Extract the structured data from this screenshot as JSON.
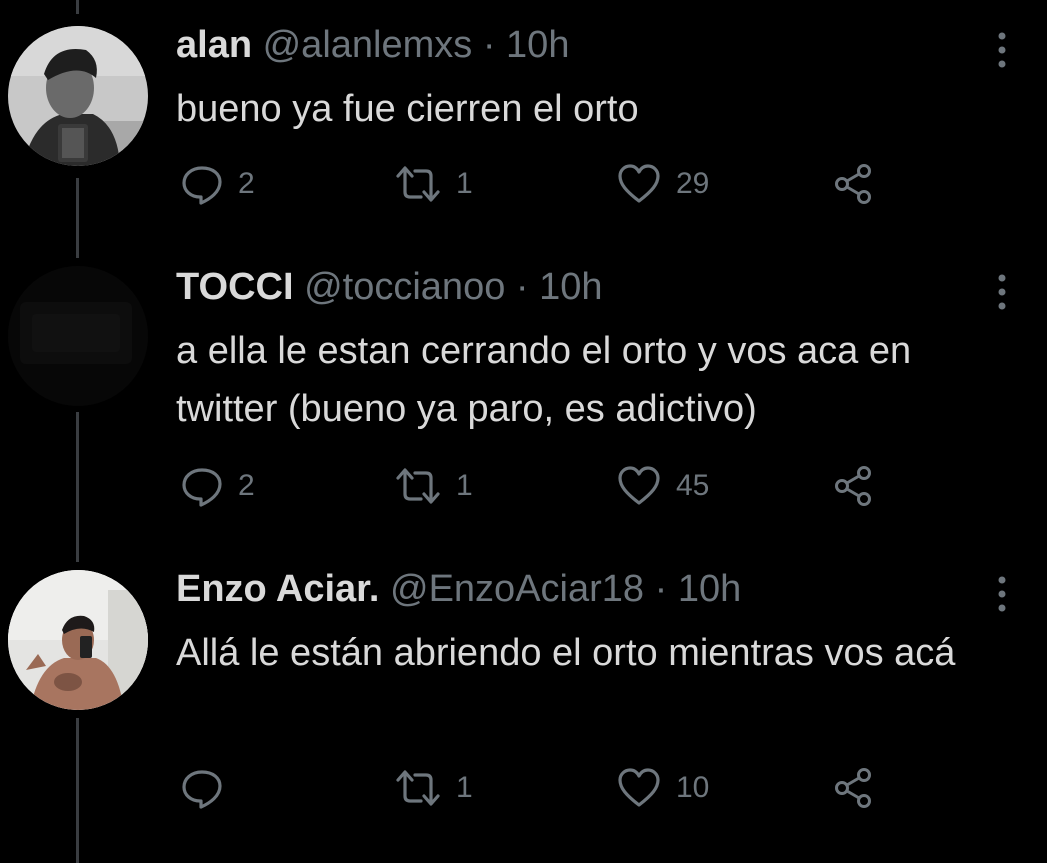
{
  "tweets": [
    {
      "name": "alan",
      "handle": "@alanlemxs",
      "separator": "·",
      "time": "10h",
      "text": "bueno ya fue cierren el orto",
      "replies": "2",
      "retweets": "1",
      "likes": "29"
    },
    {
      "name": "TOCCI",
      "handle": "@toccianoo",
      "separator": "·",
      "time": "10h",
      "text": "a ella le estan cerrando el orto y vos aca en twitter (bueno ya paro, es adictivo)",
      "replies": "2",
      "retweets": "1",
      "likes": "45"
    },
    {
      "name": "Enzo Aciar.",
      "handle": "@EnzoAciar18",
      "separator": "·",
      "time": "10h",
      "text": "Allá le están abriendo el orto mientras vos acá",
      "replies": "",
      "retweets": "1",
      "likes": "10"
    }
  ],
  "icons": {
    "reply": "speech-bubble-icon",
    "retweet": "retweet-icon",
    "like": "heart-icon",
    "share": "share-icon",
    "more": "vertical-ellipsis-icon"
  },
  "colors": {
    "background": "#000000",
    "text_primary": "#d9d9d9",
    "text_secondary": "#6e767d",
    "thread_line": "#3a3d41"
  }
}
